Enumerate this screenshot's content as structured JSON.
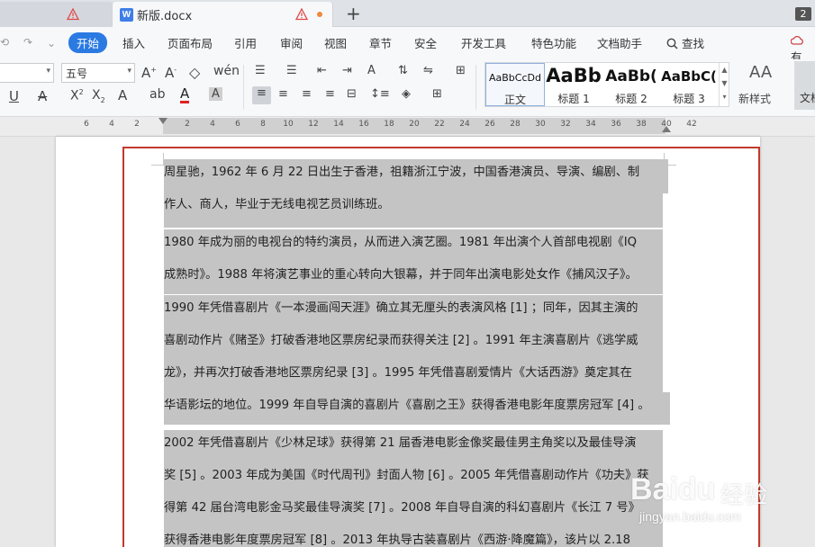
{
  "tabs": [
    {
      "label": "",
      "warning": true
    },
    {
      "label": "新版.docx",
      "warning": true,
      "unsaved": true,
      "icon": "W"
    }
  ],
  "tab_count": "2",
  "menu": {
    "start": "开始",
    "insert": "插入",
    "layout": "页面布局",
    "reference": "引用",
    "review": "审阅",
    "view": "视图",
    "section": "章节",
    "security": "安全",
    "developer": "开发工具",
    "features": "特色功能",
    "assistant": "文档助手",
    "search": "查找",
    "cloud": "有"
  },
  "ribbon": {
    "font_size": "五号",
    "doc_btn": "文档"
  },
  "styles": [
    {
      "sample": "AaBbCcDd",
      "name": "正文"
    },
    {
      "sample": "AaBb",
      "name": "标题 1"
    },
    {
      "sample": "AaBb(",
      "name": "标题 2"
    },
    {
      "sample": "AaBbC(",
      "name": "标题 3"
    }
  ],
  "new_style": {
    "glyph": "AA",
    "label": "新样式"
  },
  "ruler_ticks": [
    "6",
    "4",
    "2",
    "2",
    "4",
    "6",
    "8",
    "10",
    "12",
    "14",
    "16",
    "18",
    "20",
    "22",
    "24",
    "26",
    "28",
    "30",
    "32",
    "34",
    "36",
    "38",
    "40",
    "42"
  ],
  "document": {
    "lines": [
      "周星驰，1962 年 6 月 22 日出生于香港，祖籍浙江宁波，中国香港演员、导演、编剧、制",
      "作人、商人，毕业于无线电视艺员训练班。",
      "1980 年成为丽的电视台的特约演员，从而进入演艺圈。1981 年出演个人首部电视剧《IQ",
      "成熟时》。1988 年将演艺事业的重心转向大银幕，并于同年出演电影处女作《捕风汉子》。",
      "1990 年凭借喜剧片《一本漫画闯天涯》确立其无厘头的表演风格 [1] ；同年，因其主演的",
      "喜剧动作片《赌圣》打破香港地区票房纪录而获得关注 [2] 。1991 年主演喜剧片《逃学威",
      "龙》，并再次打破香港地区票房纪录 [3] 。1995 年凭借喜剧爱情片《大话西游》奠定其在",
      "华语影坛的地位。1999 年自导自演的喜剧片《喜剧之王》获得香港电影年度票房冠军 [4] 。",
      "2002 年凭借喜剧片《少林足球》获得第 21 届香港电影金像奖最佳男主角奖以及最佳导演",
      "奖 [5] 。2003 年成为美国《时代周刊》封面人物 [6] 。2005 年凭借喜剧动作片《功夫》获",
      "得第 42 届台湾电影金马奖最佳导演奖 [7] 。2008 年自导自演的科幻喜剧片《长江 7 号》",
      "获得香港电影年度票房冠军 [8] 。2013 年执导古装喜剧片《西游·降魔篇》，该片以 2.18"
    ]
  },
  "watermark": {
    "logo": "Baidu",
    "cn": "经验",
    "url": "jingyan.baidu.com"
  }
}
